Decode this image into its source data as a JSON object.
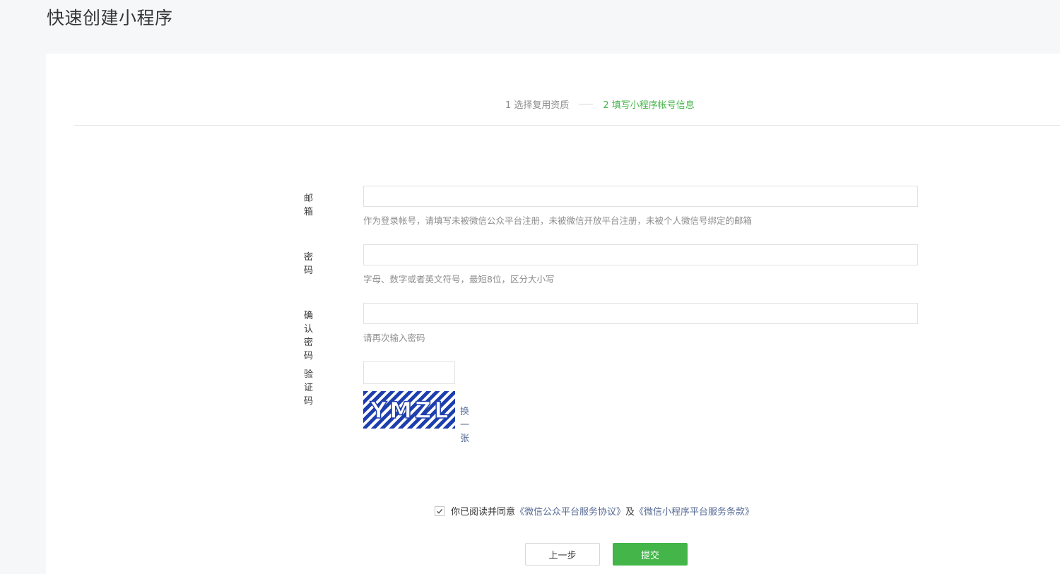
{
  "page": {
    "title": "快速创建小程序"
  },
  "steps": [
    {
      "label": "1 选择复用资质",
      "active": false
    },
    {
      "label": "2 填写小程序帐号信息",
      "active": true
    }
  ],
  "form": {
    "email": {
      "label": "邮箱",
      "value": "",
      "tip": "作为登录帐号，请填写未被微信公众平台注册，未被微信开放平台注册，未被个人微信号绑定的邮箱"
    },
    "password": {
      "label": "密码",
      "value": "",
      "tip": "字母、数字或者英文符号，最短8位，区分大小写"
    },
    "confirm_password": {
      "label": "确认密码",
      "value": "",
      "tip": "请再次输入密码"
    },
    "captcha": {
      "label": "验证码",
      "value": "",
      "refresh_label": "换一张",
      "image_text": "YMZL"
    }
  },
  "agreement": {
    "checked": true,
    "prefix": "你已阅读并同意",
    "link1": "《微信公众平台服务协议》",
    "middle": "及",
    "link2": "《微信小程序平台服务条款》"
  },
  "buttons": {
    "prev_label": "上一步",
    "submit_label": "提交"
  },
  "colors": {
    "accent": "#44b549",
    "link": "#576b95",
    "captcha_blue": "#1d3fae"
  }
}
